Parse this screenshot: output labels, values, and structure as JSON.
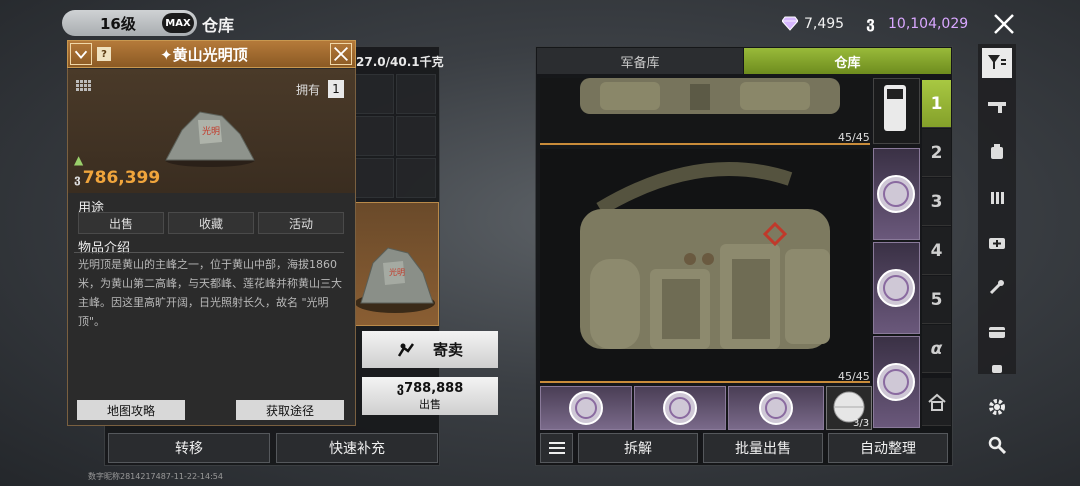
{
  "top_bar": {
    "level": "16级",
    "max_badge": "MAX",
    "title": "仓库",
    "diamonds": "7,495",
    "coin_symbol": "ვ",
    "coins": "10,104,029"
  },
  "left_panel": {
    "capacity": "27.0/40.1千克",
    "transfer_label": "转移",
    "quick_refill_label": "快速补充",
    "consign_label": "寄卖",
    "sell_price": "788,888",
    "sell_label": "出售",
    "watermark": "数字昵称2814217487-11-22-14:54"
  },
  "popup": {
    "title": "黄山光明顶",
    "owned_label": "拥有",
    "owned_count": "1",
    "price": "786,399",
    "usage_label": "用途",
    "usage_buttons": [
      "出售",
      "收藏",
      "活动"
    ],
    "intro_label": "物品介绍",
    "intro_text": "光明顶是黄山的主峰之一，位于黄山中部，海拔1860 米，为黄山第二高峰，与天都峰、莲花峰并称黄山三大主峰。因这里高旷开阔，日光照射长久，故名 \"光明顶\"。",
    "map_guide_label": "地图攻略",
    "get_route_label": "获取途径"
  },
  "right_panel": {
    "tabs": [
      "军备库",
      "仓库"
    ],
    "active_tab": "仓库",
    "bag_top_count": "45/45",
    "bag_main_count": "45/45",
    "ball_count": "3/3",
    "page_tabs": [
      "1",
      "2",
      "3",
      "4",
      "5",
      "α"
    ],
    "active_page": "1",
    "dismantle_label": "拆解",
    "batch_sell_label": "批量出售",
    "auto_arrange_label": "自动整理"
  },
  "colors": {
    "accent_green": "#99ba3a",
    "popup_header": "#b57a3a",
    "price_orange": "#f0a53c",
    "coin_purple": "#d9a7ff"
  },
  "side_icons": [
    "filter-icon",
    "gun-icon",
    "vest-icon",
    "ammo-icon",
    "medkit-icon",
    "tool-icon",
    "card-icon",
    "bag-icon",
    "settings-icon",
    "search-icon"
  ]
}
